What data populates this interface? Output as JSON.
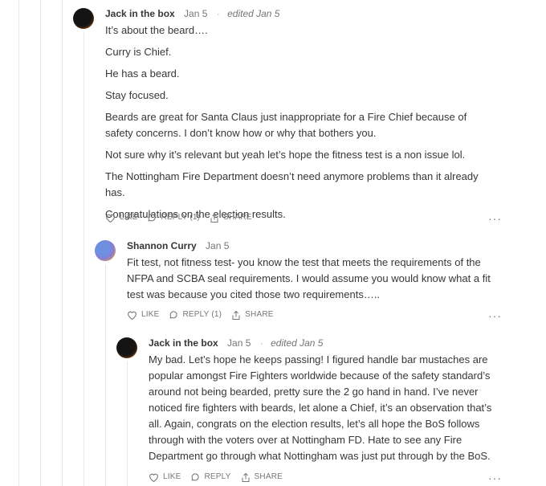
{
  "comments": [
    {
      "author": "Jack in the box",
      "date": "Jan 5",
      "separator": "·",
      "edited": "edited Jan 5",
      "paragraphs": [
        "It’s about the beard….",
        "Curry is Chief.",
        "He has a beard.",
        "Stay focused.",
        "Beards are great for Santa Claus just inappropriate for a Fire Chief because of safety concerns. I don’t know how or why that bothers you.",
        "Not sure why it’s relevant but yeah let’s hope the fitness test is a non issue lol.",
        "The Nottingham Fire Department doesn’t need anymore problems than it already has.",
        "Congratulations on the election results."
      ],
      "like_label": "LIKE",
      "reply_label": "REPLY (1)",
      "share_label": "SHARE",
      "more_label": "···"
    },
    {
      "author": "Shannon Curry",
      "date": "Jan 5",
      "paragraphs": [
        "Fit test, not fitness test- you know the test that meets the requirements of the NFPA and SCBA seal requirements. I would assume you would know what a fit test was because you cited those two requirements….."
      ],
      "like_label": "LIKE",
      "reply_label": "REPLY (1)",
      "share_label": "SHARE",
      "more_label": "···"
    },
    {
      "author": "Jack in the box",
      "date": "Jan 5",
      "separator": "·",
      "edited": "edited Jan 5",
      "paragraphs": [
        "My bad. Let’s hope he keeps passing! I figured handle bar mustaches are popular amongst Fire Fighters worldwide because of the safety standard’s around not being bearded, pretty sure the 2 go hand in hand. I’ve never noticed fire fighters with beards, let alone a Chief, it’s an observation that’s all. Again, congrats on the election results, let’s all hope the BoS follows through with the voters over at Nottingham FD. Hate to see any Fire Department go through what Nottingham was just put through by the BoS."
      ],
      "like_label": "LIKE",
      "reply_label": "REPLY",
      "share_label": "SHARE",
      "more_label": "···"
    }
  ]
}
